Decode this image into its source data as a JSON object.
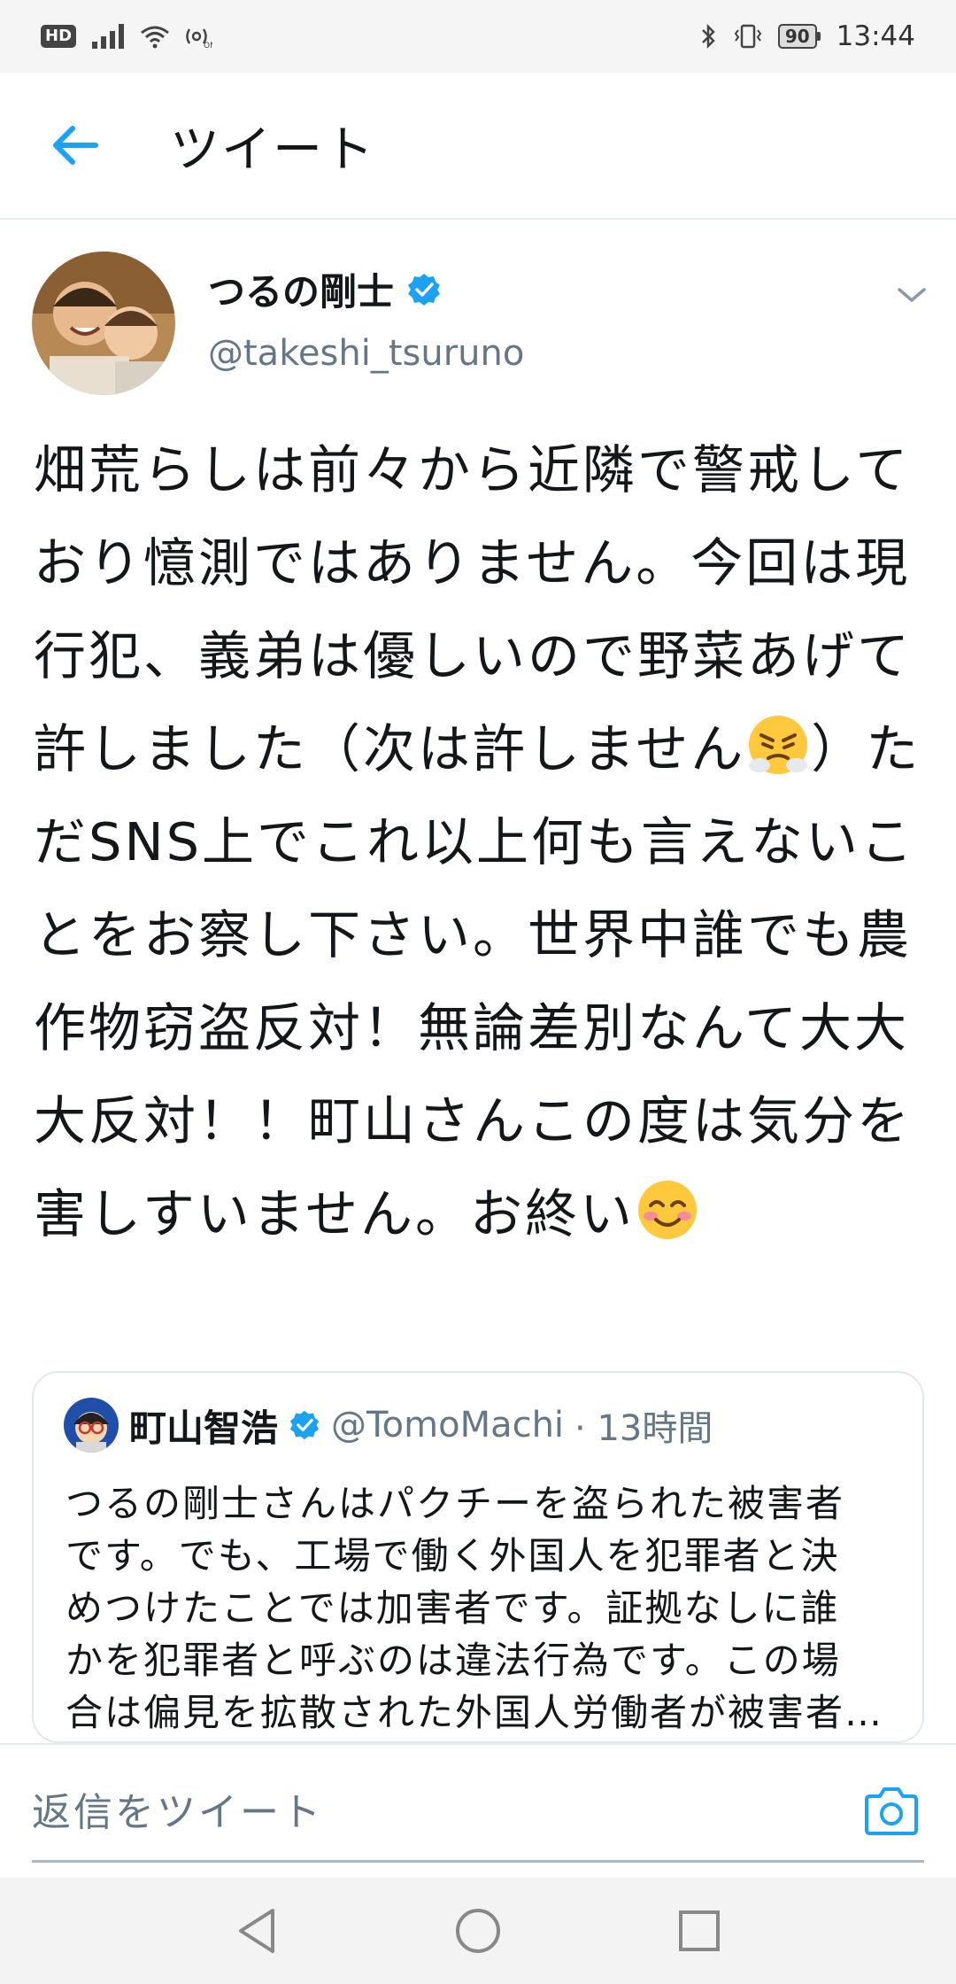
{
  "status_bar": {
    "hd": "HD",
    "battery": "90",
    "time": "13:44"
  },
  "header": {
    "title": "ツイート",
    "back_icon": "arrow-left-icon"
  },
  "tweet": {
    "author_name": "つるの剛士",
    "author_handle": "@takeshi_tsuruno",
    "verified": true,
    "text_before_emoji1": "畑荒らしは前々から近隣で警戒しており憶測ではありません。今回は現行犯、義弟は優しいので野菜あげて許しました（次は許しません",
    "text_between": "）ただSNS上でこれ以上何も言えないことをお察し下さい。世界中誰でも農作物窃盗反対！無論差別なんて大大大反対！！町山さんこの度は気分を害しすいません。お終い",
    "emoji1": "steam-from-nose-face-icon",
    "emoji2": "smiling-blush-face-icon"
  },
  "quote": {
    "author_name": "町山智浩",
    "author_handle": "@TomoMachi",
    "time": "· 13時間",
    "lines": [
      "つるの剛士さんはパクチーを盗られた被害者",
      "です。でも、工場で働く外国人を犯罪者と決",
      "めつけたことでは加害者です。証拠なしに誰",
      "かを犯罪者と呼ぶのは違法行為です。この場",
      "合は偏見を拡散された外国人労働者が被害者…"
    ]
  },
  "reply": {
    "placeholder": "返信をツイート"
  },
  "colors": {
    "accent": "#1da1f2",
    "secondary_text": "#657786",
    "divider": "#e6ecf0"
  }
}
